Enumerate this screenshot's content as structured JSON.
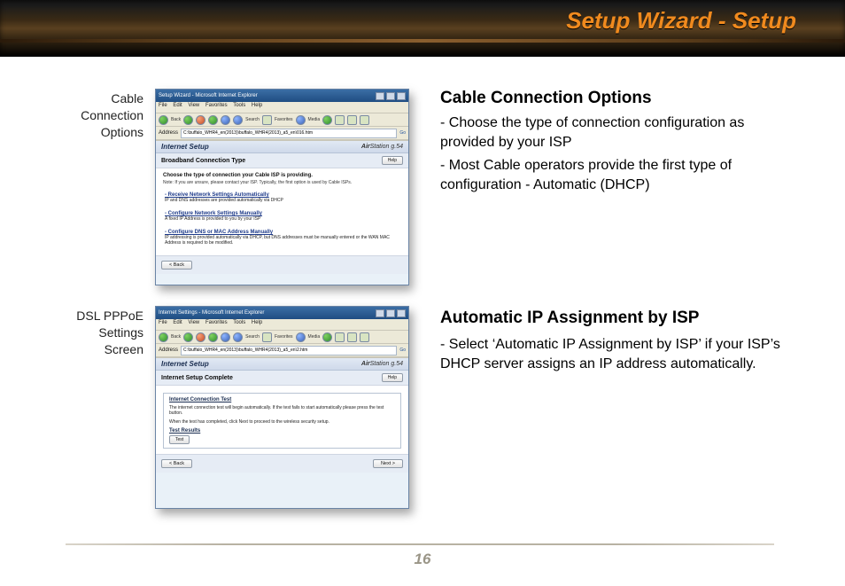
{
  "header": {
    "title": "Setup Wizard - Setup"
  },
  "labelA": {
    "l1": "Cable",
    "l2": "Connection",
    "l3": "Options"
  },
  "labelB": {
    "l1": "DSL PPPoE",
    "l2": "Settings",
    "l3": "Screen"
  },
  "shotA": {
    "win_title": "Setup Wizard - Microsoft Internet Explorer",
    "menu": {
      "file": "File",
      "edit": "Edit",
      "view": "View",
      "fav": "Favorites",
      "tools": "Tools",
      "help": "Help"
    },
    "toolbar": {
      "back": "Back",
      "search": "Search",
      "fav": "Favorites",
      "media": "Media"
    },
    "addr_label": "Address",
    "addr_value": "C:\\buffalo_WHR4_en(2013)\\buffalo_WHR4(2013)_a5_en\\016.htm",
    "go": "Go",
    "header_title": "Internet Setup",
    "brand_a": "Air",
    "brand_b": "Station",
    "brand_c": " g.54",
    "sub_title": "Broadband Connection Type",
    "help": "Help",
    "lead": "Choose the type of connection your Cable ISP is providing.",
    "note": "Note: If you are unsure, please contact your ISP. Typically, the first option is used by Cable ISPs.",
    "opt1_t": "- Receive Network Settings Automatically",
    "opt1_d": "IP and DNS addresses are provided automatically via DHCP",
    "opt2_t": "- Configure Network Settings Manually",
    "opt2_d": "A fixed IP Address is provided to you by your ISP",
    "opt3_t": "- Configure DNS or MAC Address Manually",
    "opt3_d": "IP addressing is provided automatically via DHCP, but DNS addresses must be manually entered or the WAN MAC Address is required to be modified.",
    "back": "< Back"
  },
  "shotB": {
    "win_title": "Internet Settings - Microsoft Internet Explorer",
    "menu": {
      "file": "File",
      "edit": "Edit",
      "view": "View",
      "fav": "Favorites",
      "tools": "Tools",
      "help": "Help"
    },
    "toolbar": {
      "back": "Back",
      "search": "Search",
      "fav": "Favorites",
      "media": "Media"
    },
    "addr_label": "Address",
    "addr_value": "C:\\buffalo_WHR4_en(2013)\\buffalo_WHR4(2013)_a5_en\\2.htm",
    "go": "Go",
    "header_title": "Internet Setup",
    "brand_a": "Air",
    "brand_b": "Station",
    "brand_c": " g.54",
    "sub_title": "Internet Setup Complete",
    "help": "Help",
    "ict_title": "Internet Connection Test",
    "ict_p1": "The internet connection test will begin automatically. If the test fails to start automatically please press the test button.",
    "ict_p2": "When the test has completed, click Next to proceed to the wireless security setup.",
    "res_title": "Test Results",
    "test": "Test",
    "back": "< Back",
    "next": "Next >"
  },
  "copy": {
    "h1": "Cable Connection Options",
    "p1": "- Choose the type of connection configuration as provided by your ISP",
    "p2": "- Most Cable operators provide the first type of configuration - Automatic (DHCP)",
    "h2": "Automatic IP Assignment by ISP",
    "p3": "- Select ‘Automatic IP Assignment by ISP’  if your ISP’s DHCP server assigns an IP address automatically."
  },
  "footer": {
    "page": "16"
  }
}
